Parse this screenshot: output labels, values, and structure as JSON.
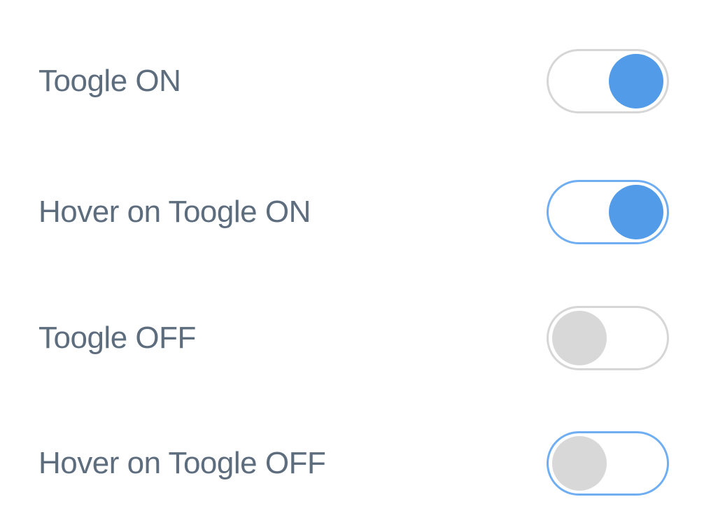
{
  "toggles": [
    {
      "label": "Toogle ON",
      "state": "on",
      "hover": false
    },
    {
      "label": "Hover on Toogle ON",
      "state": "on",
      "hover": true
    },
    {
      "label": "Toogle OFF",
      "state": "off",
      "hover": false
    },
    {
      "label": "Hover on Toogle OFF",
      "state": "off",
      "hover": true
    }
  ],
  "colors": {
    "label_text": "#5d6d7e",
    "track_border": "#d6d6d6",
    "track_border_hover": "#6faef2",
    "knob_on": "#519be8",
    "knob_off": "#d8d8d8"
  }
}
